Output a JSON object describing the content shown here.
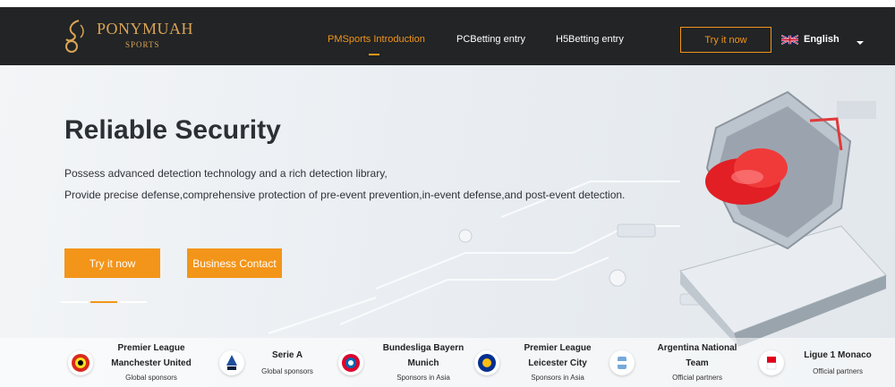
{
  "nav": {
    "brand": "PONYMUAH",
    "brand_sub": "SPORTS",
    "links": [
      "PMSports Introduction",
      "PCBetting entry",
      "H5Betting entry"
    ],
    "try_label": "Try it now",
    "language": "English"
  },
  "hero": {
    "title": "Reliable Security",
    "line1": "Possess advanced detection technology and a rich detection library,",
    "line2": "Provide precise defense,comprehensive protection of pre-event prevention,in-event defense,and post-event detection.",
    "try_label": "Try it now",
    "contact_label": "Business Contact"
  },
  "sponsors": [
    {
      "icon": "manchester-united-crest-icon",
      "line1": "Premier League",
      "line2": "Manchester United",
      "line3": "Global sponsors"
    },
    {
      "icon": "serie-a-logo-icon",
      "line1": "Serie A",
      "line2": "",
      "line3": "Global sponsors"
    },
    {
      "icon": "bayern-munich-crest-icon",
      "line1": "Bundesliga Bayern",
      "line2": "Munich",
      "line3": "Sponsors in Asia"
    },
    {
      "icon": "leicester-city-crest-icon",
      "line1": "Premier League",
      "line2": "Leicester City",
      "line3": "Sponsors in Asia"
    },
    {
      "icon": "argentina-afa-crest-icon",
      "line1": "Argentina National",
      "line2": "Team",
      "line3": "Official partners"
    },
    {
      "icon": "monaco-crest-icon",
      "line1": "Ligue 1 Monaco",
      "line2": "",
      "line3": "Official partners"
    }
  ],
  "colors": {
    "accent": "#f39519",
    "nav_bg": "#222426",
    "brand_gold": "#d9a454"
  }
}
